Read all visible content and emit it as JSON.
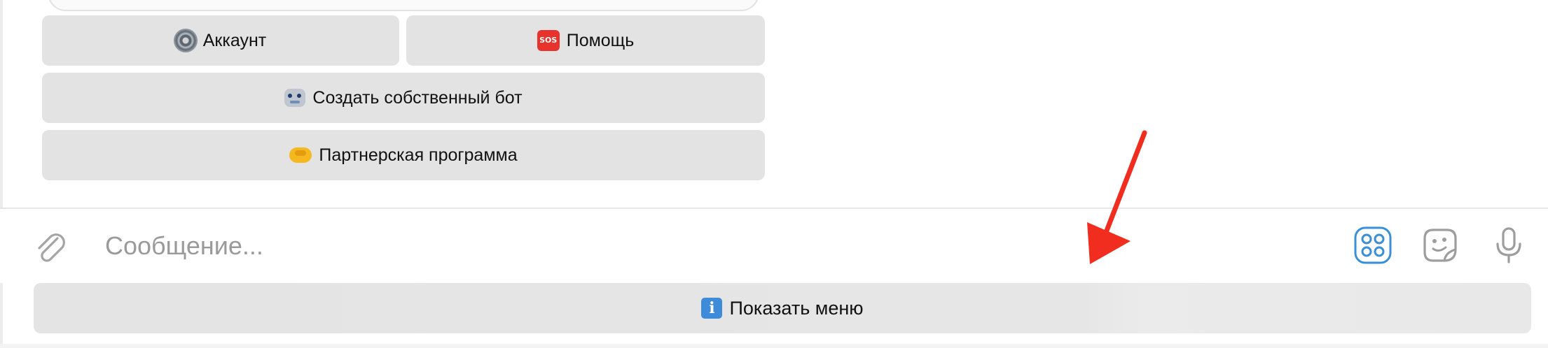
{
  "keyboard": {
    "buttons": [
      {
        "id": "account",
        "label": "Аккаунт",
        "icon": "gear-icon"
      },
      {
        "id": "help",
        "label": "Помощь",
        "icon": "sos-icon"
      },
      {
        "id": "create-bot",
        "label": "Создать собственный бот",
        "icon": "robot-icon"
      },
      {
        "id": "partner",
        "label": "Партнерская программа",
        "icon": "handshake-icon"
      }
    ]
  },
  "composer": {
    "placeholder": "Сообщение...",
    "value": "",
    "icons": [
      "paperclip-icon",
      "bot-commands-icon",
      "sticker-icon",
      "microphone-icon"
    ],
    "accent_color": "#3a8fd9"
  },
  "menu_button": {
    "label": "Показать меню",
    "icon": "info-icon"
  },
  "annotation": {
    "arrow_color": "#f02d1f"
  }
}
